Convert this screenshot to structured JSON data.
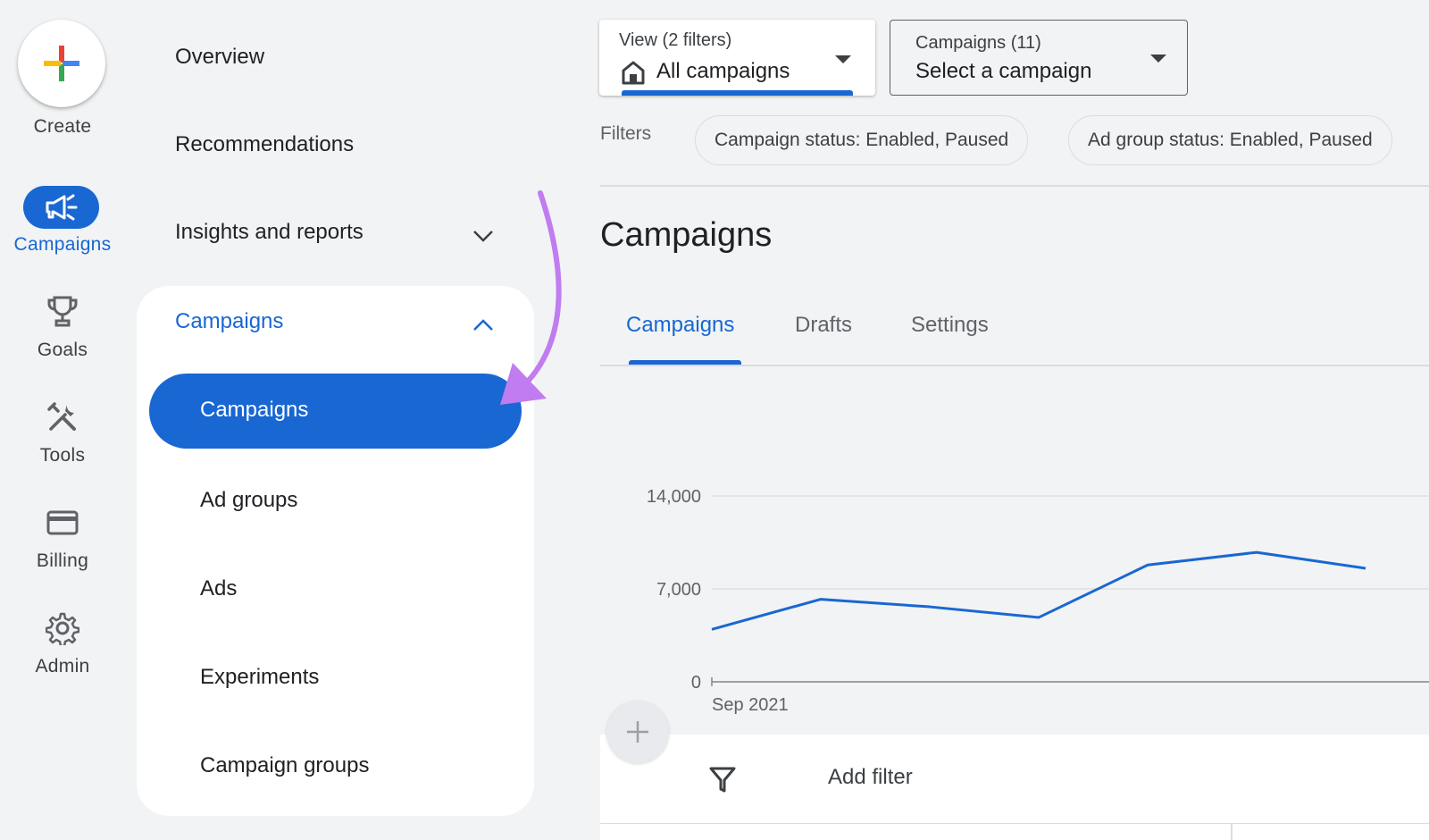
{
  "rail": {
    "create_label": "Create",
    "items": [
      {
        "label": "Campaigns",
        "icon": "megaphone-icon",
        "active": true
      },
      {
        "label": "Goals",
        "icon": "trophy-icon"
      },
      {
        "label": "Tools",
        "icon": "tools-icon"
      },
      {
        "label": "Billing",
        "icon": "credit-card-icon"
      },
      {
        "label": "Admin",
        "icon": "gear-icon"
      }
    ]
  },
  "nav": {
    "overview": "Overview",
    "recommendations": "Recommendations",
    "insights": "Insights and reports",
    "section_title": "Campaigns",
    "active_item": "Campaigns",
    "sub_items": [
      "Ad groups",
      "Ads",
      "Experiments",
      "Campaign groups"
    ]
  },
  "header": {
    "view_small": "View (2 filters)",
    "view_value": "All campaigns",
    "campaign_small": "Campaigns (11)",
    "campaign_value": "Select a campaign",
    "filters_label": "Filters",
    "chips": [
      "Campaign status: Enabled, Paused",
      "Ad group status: Enabled, Paused"
    ]
  },
  "main": {
    "title": "Campaigns",
    "tabs": [
      "Campaigns",
      "Drafts",
      "Settings"
    ],
    "add_filter": "Add filter"
  },
  "colors": {
    "accent": "#1967d2",
    "arrow": "#c07cf0"
  },
  "chart_data": {
    "type": "line",
    "yticks": [
      "14,000",
      "7,000",
      "0"
    ],
    "ylim": [
      0,
      14000
    ],
    "x_label_first": "Sep 2021",
    "series": [
      {
        "values": [
          3950,
          6220,
          5650,
          4850,
          8800,
          9750,
          8550
        ]
      }
    ]
  }
}
